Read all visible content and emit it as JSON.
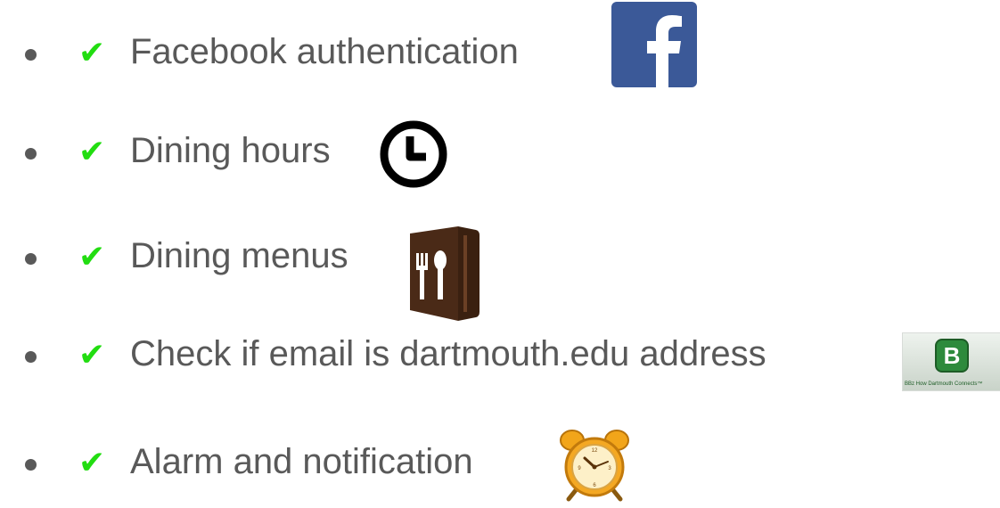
{
  "items": [
    {
      "check": "✔",
      "label": "Facebook authentication",
      "icon": "facebook-logo-icon"
    },
    {
      "check": "✔",
      "label": "Dining hours",
      "icon": "clock-icon"
    },
    {
      "check": "✔",
      "label": "Dining menus",
      "icon": "dining-menu-icon"
    },
    {
      "check": "✔",
      "label": "Check if email is dartmouth.edu address",
      "icon": "bbz-logo-icon"
    },
    {
      "check": "✔",
      "label": "Alarm and notification",
      "icon": "alarm-clock-icon"
    }
  ],
  "bbz_logo": {
    "letter": "B",
    "caption": "BBz How Dartmouth Connects™"
  },
  "colors": {
    "check": "#22dd11",
    "text": "#595959",
    "bullet": "#595959",
    "facebook": "#3b5998"
  }
}
